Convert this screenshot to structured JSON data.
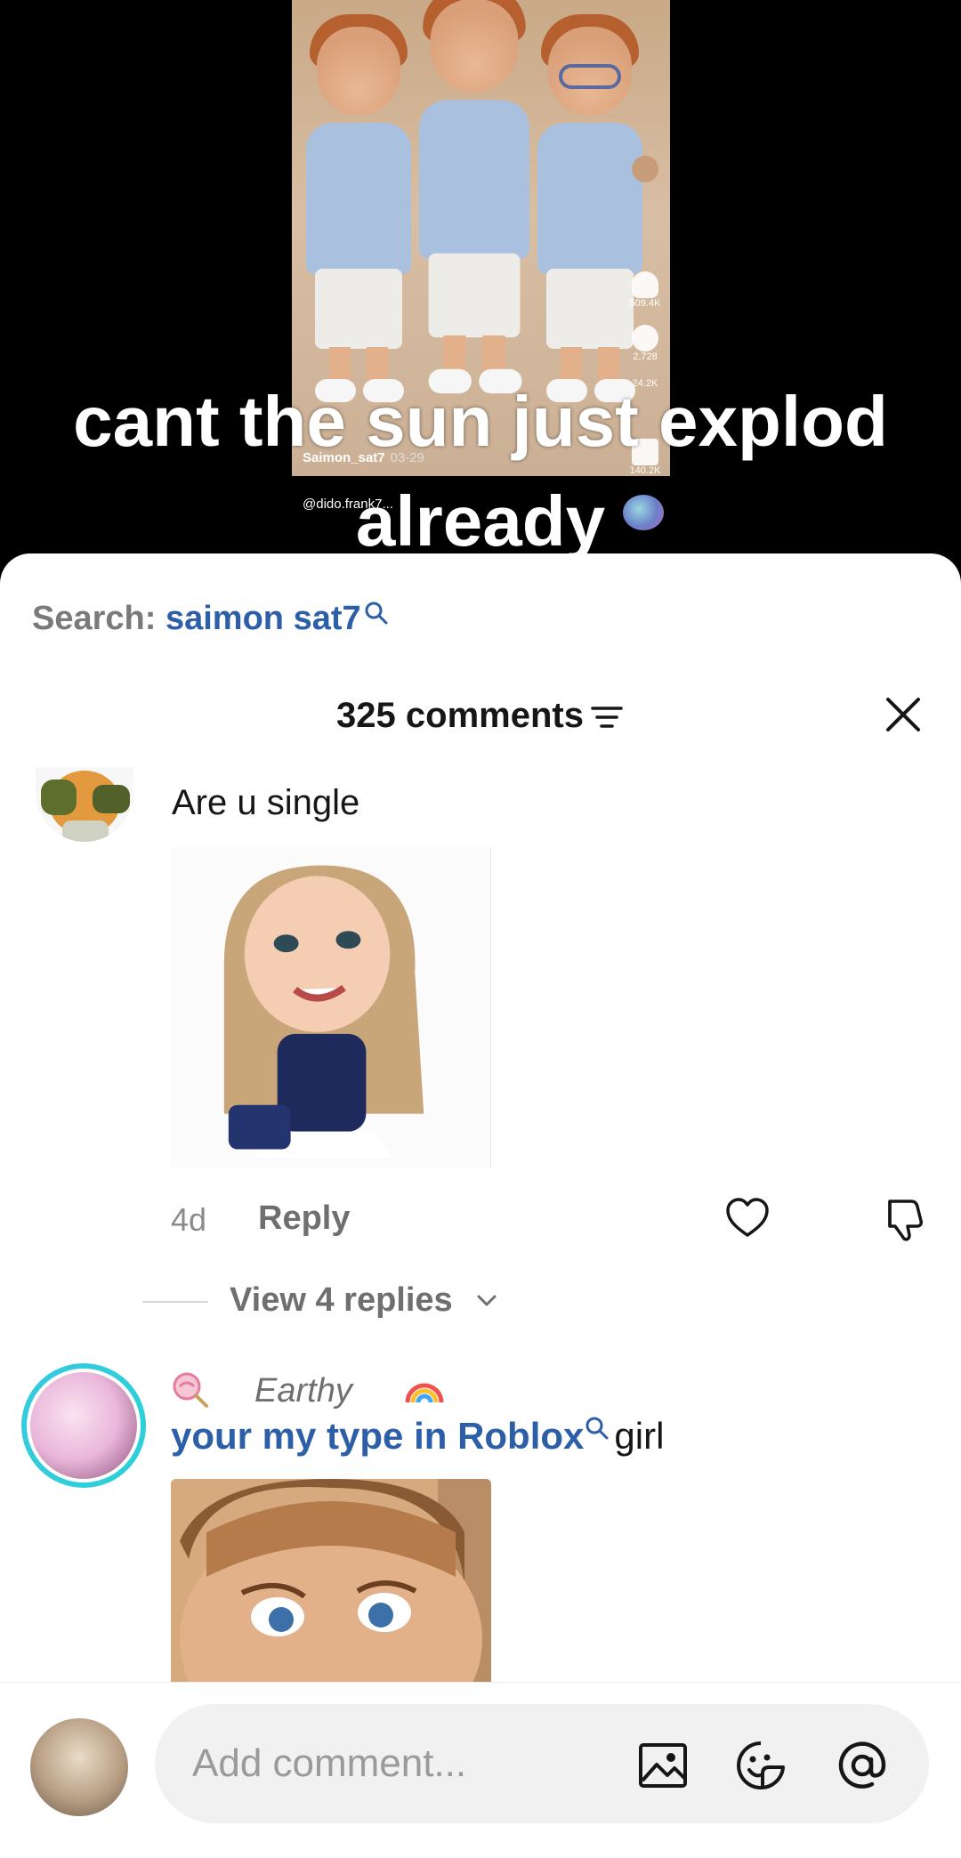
{
  "video": {
    "caption": "cant the sun just explod already",
    "inner_username": "Saimon_sat7",
    "inner_date": "03-29",
    "inner_handle": "@dido.frank7...",
    "side_likes": "509.4K",
    "side_comments": "2,728",
    "side_saves": "24.2K",
    "side_shares": "140.2K"
  },
  "search": {
    "label": "Search:",
    "term": "saimon sat7"
  },
  "comments_header": {
    "count_label": "325 comments"
  },
  "comments": [
    {
      "text": "Are u single",
      "time": "4d",
      "reply_label": "Reply",
      "view_replies_label": "View 4 replies"
    },
    {
      "username": "Earthy",
      "mention": "your my type in Roblox",
      "text": "girl"
    }
  ],
  "input_bar": {
    "placeholder": "Add comment..."
  },
  "colors": {
    "accent_link": "#2d5fa8",
    "avatar_ring": "#38c9e0",
    "sheet_bg": "#ffffff",
    "muted_text": "#6f6f6f"
  }
}
